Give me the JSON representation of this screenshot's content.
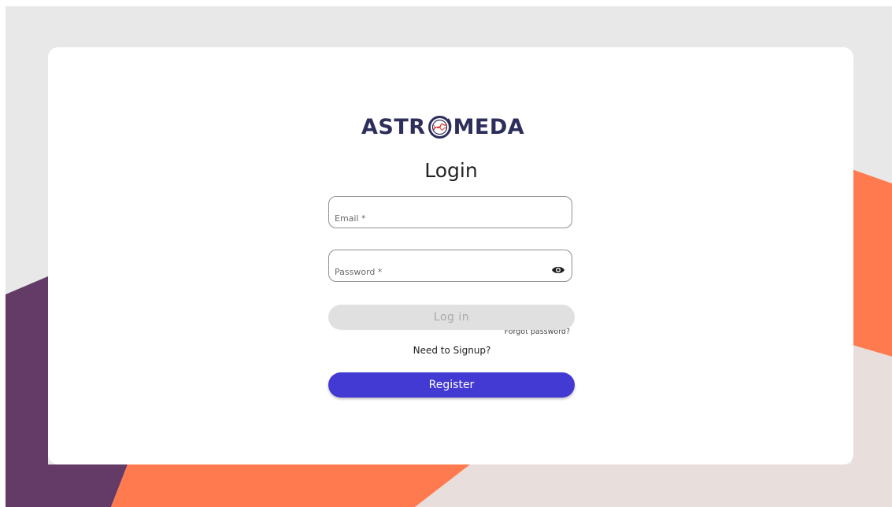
{
  "brand": {
    "logo_left": "ASTR",
    "logo_right": "MEDA",
    "color": "#2d2e5c",
    "accent": "#d83b2e"
  },
  "colors": {
    "background": "#e8e8e8",
    "orange": "#ff7b4f",
    "purple": "#643a66",
    "blush": "#e8dedb",
    "primary": "#4339d3"
  },
  "login": {
    "title": "Login",
    "email_placeholder": "Email *",
    "password_placeholder": "Password *",
    "password_toggle_icon": "eye-icon",
    "forgot_password": "Forgot password?",
    "login_button": "Log in",
    "signup_prompt": "Need to Signup?",
    "register_button": "Register"
  }
}
